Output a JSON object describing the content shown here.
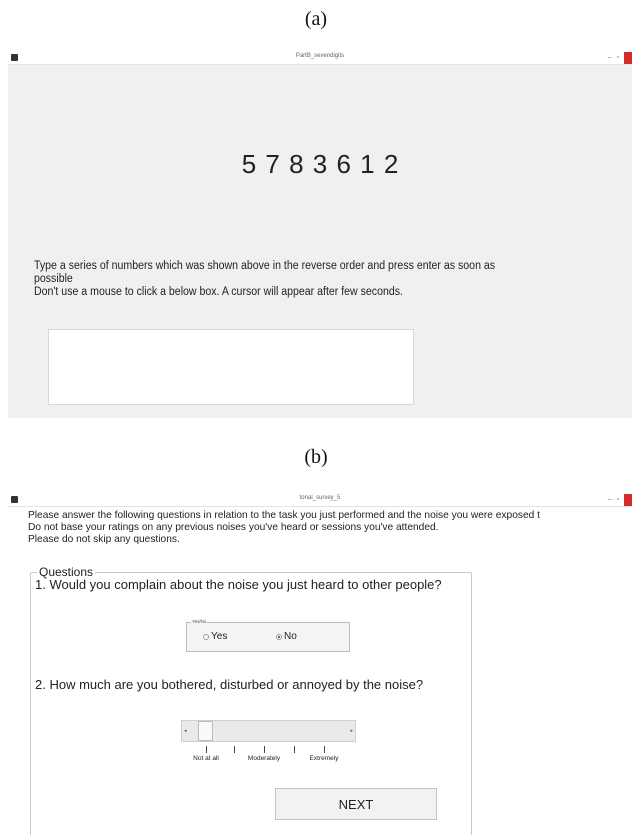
{
  "panel_a": {
    "label": "(a)",
    "window_title": "PartB_sevendigits",
    "digits": "5 7 8 3 6 1 2",
    "instruction_line1": "Type a series of numbers which was shown above in the reverse order and press enter as soon as",
    "instruction_line2": "possible",
    "instruction_line3": "Don't use a mouse to click a below box. A cursor will appear after few seconds.",
    "answer_value": "",
    "min_symbol": "–",
    "max_symbol": "▫"
  },
  "panel_b": {
    "label": "(b)",
    "window_title": "tonal_survey_5",
    "intro_line1": "Please answer the following questions in relation to the task you just performed and the noise you were exposed t",
    "intro_line2": "Do not base your ratings on any previous noises you've heard or sessions you've attended.",
    "intro_line3": "Please do not skip any questions.",
    "group_title": "Questions",
    "q1": "1. Would you complain about the noise you just heard to other people?",
    "radio_group_label": "Yes/No",
    "options": [
      "Yes",
      "No"
    ],
    "selected_option": "No",
    "q2": "2. How much are you bothered, disturbed or annoyed by the noise?",
    "slider_labels": [
      "Not at all",
      "Moderately",
      "Extremely"
    ],
    "slider_value_fraction": 0.0,
    "next_label": "NEXT",
    "min_symbol": "–",
    "max_symbol": "▫"
  },
  "colors": {
    "close_button": "#d62b2b",
    "window_bg": "#f0f0f0"
  },
  "icons": [
    "app-icon",
    "minimize-icon",
    "maximize-icon",
    "close-icon",
    "arrow-left-icon",
    "arrow-right-icon"
  ]
}
